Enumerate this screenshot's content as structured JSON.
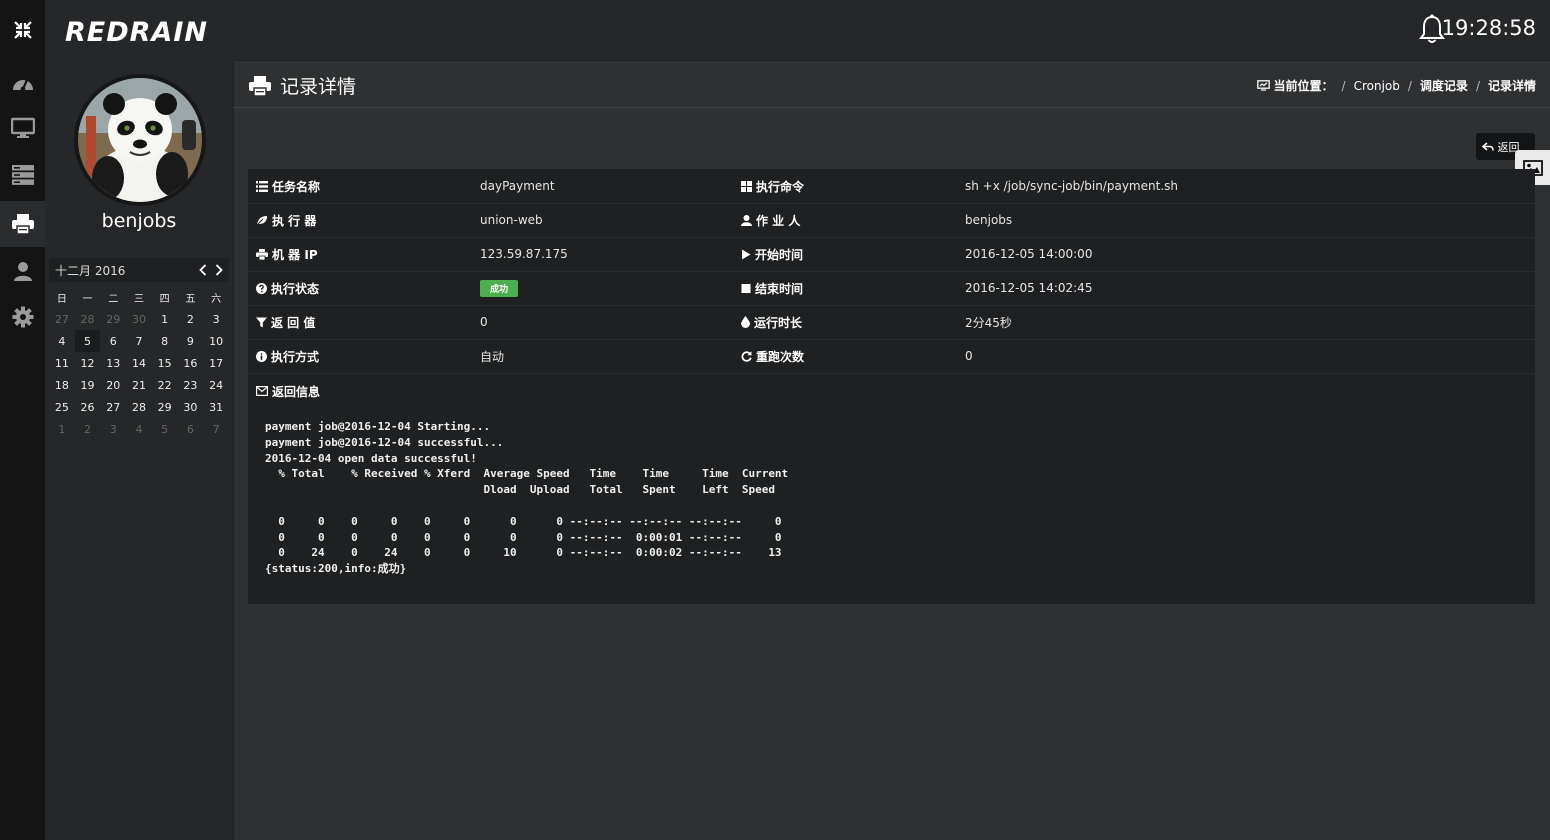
{
  "brand": {
    "logo_text": "REDRAIN"
  },
  "rail": {
    "items": [
      {
        "icon": "dashboard-icon"
      },
      {
        "icon": "monitor-icon"
      },
      {
        "icon": "server-icon"
      },
      {
        "icon": "printer-icon",
        "active": true
      },
      {
        "icon": "user-icon"
      },
      {
        "icon": "gear-icon"
      }
    ]
  },
  "profile": {
    "username": "benjobs"
  },
  "calendar": {
    "title": "十二月 2016",
    "weekdays": [
      "日",
      "一",
      "二",
      "三",
      "四",
      "五",
      "六"
    ],
    "weeks": [
      [
        "27",
        "28",
        "29",
        "30",
        "1",
        "2",
        "3"
      ],
      [
        "4",
        "5",
        "6",
        "7",
        "8",
        "9",
        "10"
      ],
      [
        "11",
        "12",
        "13",
        "14",
        "15",
        "16",
        "17"
      ],
      [
        "18",
        "19",
        "20",
        "21",
        "22",
        "23",
        "24"
      ],
      [
        "25",
        "26",
        "27",
        "28",
        "29",
        "30",
        "31"
      ],
      [
        "1",
        "2",
        "3",
        "4",
        "5",
        "6",
        "7"
      ]
    ]
  },
  "topbar": {
    "time": "19:28:58"
  },
  "page": {
    "title": "记录详情",
    "breadcrumb": {
      "label": "当前位置：",
      "items": [
        "Cronjob",
        "调度记录",
        "记录详情"
      ]
    },
    "back_label": "返回"
  },
  "detail": {
    "rows": [
      {
        "l_label": "任务名称",
        "l_value": "dayPayment",
        "r_label": "执行命令",
        "r_value": "sh +x /job/sync-job/bin/payment.sh"
      },
      {
        "l_label": "执 行 器",
        "l_value": "union-web",
        "r_label": "作 业 人",
        "r_value": "benjobs"
      },
      {
        "l_label": "机 器 IP",
        "l_value": "123.59.87.175",
        "r_label": "开始时间",
        "r_value": "2016-12-05 14:00:00"
      },
      {
        "l_label": "执行状态",
        "l_value": "成功",
        "r_label": "结束时间",
        "r_value": "2016-12-05 14:02:45"
      },
      {
        "l_label": "返 回 值",
        "l_value": "0",
        "r_label": "运行时长",
        "r_value": "2分45秒"
      },
      {
        "l_label": "执行方式",
        "l_value": "自动",
        "r_label": "重跑次数",
        "r_value": "0"
      }
    ],
    "message_label": "返回信息",
    "log": "payment job@2016-12-04 Starting...\npayment job@2016-12-04 successful...\n2016-12-04 open data successful!\n  % Total    % Received % Xferd  Average Speed   Time    Time     Time  Current\n                                 Dload  Upload   Total   Spent    Left  Speed\n\n  0     0    0     0    0     0      0      0 --:--:-- --:--:-- --:--:--     0\n  0     0    0     0    0     0      0      0 --:--:--  0:00:01 --:--:--     0\n  0    24    0    24    0     0     10      0 --:--:--  0:00:02 --:--:--    13\n{status:200,info:成功}",
    "status_color": "#4cae4c"
  }
}
